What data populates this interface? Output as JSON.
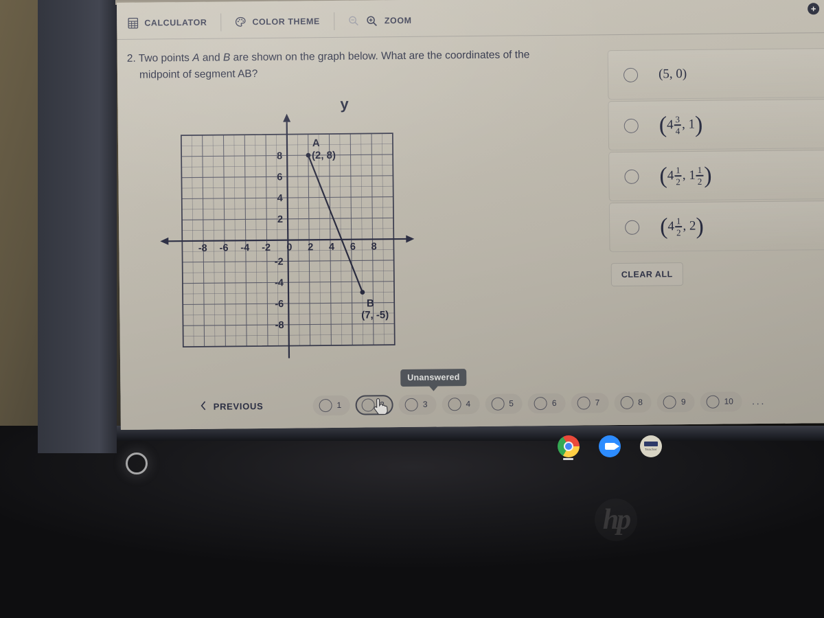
{
  "toolbar": {
    "calculator_label": "CALCULATOR",
    "calculator_icon": "calculator-icon",
    "color_theme_label": "COLOR THEME",
    "color_theme_icon": "palette-icon",
    "zoom_label": "ZOOM",
    "zoom_out_icon": "magnifier-minus-icon",
    "zoom_in_icon": "magnifier-plus-icon",
    "plus_badge": "+"
  },
  "question": {
    "number": "2.",
    "line1_a": "Two points ",
    "line1_var_a": "A",
    "line1_b": " and ",
    "line1_var_b": "B",
    "line1_c": " are shown on the graph below.  What are the coordinates of the",
    "line2": "midpoint of segment AB?"
  },
  "chart_data": {
    "type": "scatter",
    "title": "",
    "xlabel": "",
    "ylabel": "y",
    "xlim": [
      -10,
      10
    ],
    "ylim": [
      -10,
      10
    ],
    "grid": true,
    "x_ticks": [
      -8,
      -6,
      -4,
      -2,
      0,
      2,
      4,
      6,
      8
    ],
    "y_ticks": [
      8,
      6,
      4,
      2,
      -2,
      -4,
      -6,
      -8
    ],
    "x_tick_labels": [
      "-8",
      "-6",
      "-4",
      "-2",
      "0",
      "2",
      "4",
      "6",
      "8"
    ],
    "y_tick_labels": [
      "8",
      "6",
      "4",
      "2",
      "-2",
      "-4",
      "-6",
      "-8"
    ],
    "points": [
      {
        "name": "A",
        "label": "A",
        "coord_label": "(2, 8)",
        "x": 2,
        "y": 8
      },
      {
        "name": "B",
        "label": "B",
        "coord_label": "(7, -5)",
        "x": 7,
        "y": -5
      }
    ],
    "segments": [
      {
        "from": "A",
        "to": "B",
        "x1": 2,
        "y1": 8,
        "x2": 7,
        "y2": -5
      }
    ]
  },
  "tooltip": {
    "text": "Unanswered"
  },
  "answers": {
    "options": [
      {
        "id": "a",
        "text": "(5, 0)",
        "kind": "plain",
        "selected": false
      },
      {
        "id": "b",
        "kind": "mixed2",
        "whole_x": "4",
        "num_x": "3",
        "den_x": "4",
        "y_plain": "1",
        "selected": false
      },
      {
        "id": "c",
        "kind": "mixed_mixed",
        "whole_x": "4",
        "num_x": "1",
        "den_x": "2",
        "whole_y": "1",
        "num_y": "1",
        "den_y": "2",
        "selected": false
      },
      {
        "id": "d",
        "kind": "mixed2",
        "whole_x": "4",
        "num_x": "1",
        "den_x": "2",
        "y_plain": "2",
        "selected": false
      }
    ],
    "clear_all_label": "CLEAR ALL"
  },
  "footer": {
    "previous_label": "PREVIOUS",
    "previous_icon": "chevron-left-icon",
    "cursor_icon": "pointer-hand-icon",
    "current_page": "2",
    "pages": [
      "1",
      "2",
      "3",
      "4",
      "5",
      "6",
      "7",
      "8",
      "9",
      "10"
    ],
    "ellipsis": "..."
  },
  "taskbar": {
    "items": [
      {
        "name": "chrome-icon",
        "label": ""
      },
      {
        "name": "zoom-app-icon",
        "label": ""
      },
      {
        "name": "docs-app-icon",
        "label": "Teacher"
      }
    ]
  },
  "device": {
    "brand": "hp",
    "power_icon": "power-indicator-icon"
  }
}
